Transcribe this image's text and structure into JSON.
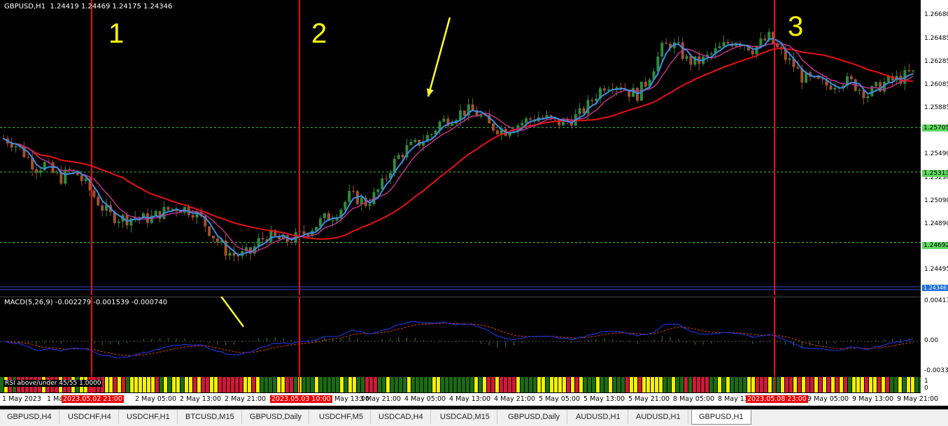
{
  "chart_header": {
    "symbol_line": "GBPUSD,H1  1.24419 1.24469 1.24175 1.24346"
  },
  "annotations": {
    "region_labels": [
      "1",
      "2",
      "3"
    ]
  },
  "colors": {
    "background": "#000000",
    "bull_candle": "#2e8b3a",
    "bear_candle": "#a0522d",
    "fast_ma": "#3a8ee6",
    "mid_ma": "#c0308a",
    "slow_ma": "#e81010",
    "vertical_lines": "#e81010",
    "arrows": "#ffff33",
    "level_lines": "#3cc83c"
  },
  "price_axis": {
    "labels": [
      "1.26680",
      "1.26485",
      "1.26285",
      "1.26085",
      "1.25885",
      "1.25490",
      "1.25290",
      "1.25090",
      "1.24890",
      "1.24495"
    ],
    "markers": [
      "1.25705",
      "1.25313",
      "1.24692"
    ],
    "current_price": "1.24346"
  },
  "macd": {
    "title": "MACD(5,26,9) -0.002279 -0.001539 -0.000740",
    "scale": [
      "0.00417",
      "0.00",
      "-0.00337"
    ]
  },
  "rsi": {
    "title": "RSI above/under 45/55 1.0000",
    "scale": [
      "1",
      "0"
    ]
  },
  "time_axis": {
    "labels": [
      "1 May 2023",
      "1 May",
      "2 May 05:00",
      "2 May 13:00",
      "2 May 21:00",
      "3 May 13:00",
      "3 May 21:00",
      "4 May 05:00",
      "4 May 13:00",
      "4 May 21:00",
      "5 May 05:00",
      "5 May 13:00",
      "5 May 21:00",
      "8 May 05:00",
      "8 May 13",
      "9 May 05:00",
      "9 May 13:00",
      "9 May 21:00"
    ],
    "markers": [
      "2023.05.02 21:00",
      "2023.05.03 10:00",
      "2023.05.08 23:00"
    ]
  },
  "tabs": [
    "GBPUSD,H4",
    "USDCHF,H4",
    "USDCHF,H1",
    "BTCUSD,M15",
    "GBPUSD,Daily",
    "USDCHF,M5",
    "USDCAD,H4",
    "USDCAD,M15",
    "GBPUSD,Daily",
    "AUDUSD,H1",
    "AUDUSD,H1",
    "GBPUSD,H1"
  ],
  "active_tab": "GBPUSD,H1",
  "chart_data": {
    "type": "candlestick",
    "symbol": "GBPUSD",
    "timeframe": "H1",
    "ylim": [
      1.243,
      1.268
    ],
    "close_path": [
      1.2561,
      1.2558,
      1.2552,
      1.2543,
      1.2535,
      1.2538,
      1.253,
      1.2526,
      1.2532,
      1.2529,
      1.252,
      1.251,
      1.25,
      1.2493,
      1.2491,
      1.249,
      1.2492,
      1.249,
      1.2491,
      1.2495,
      1.2498,
      1.25,
      1.2499,
      1.2497,
      1.249,
      1.248,
      1.247,
      1.2462,
      1.2458,
      1.2458,
      1.246,
      1.247,
      1.2475,
      1.2473,
      1.247,
      1.2472,
      1.2475,
      1.248,
      1.2485,
      1.249,
      1.2493,
      1.25,
      1.251,
      1.2508,
      1.2504,
      1.251,
      1.252,
      1.2535,
      1.2545,
      1.2552,
      1.2555,
      1.256,
      1.2565,
      1.2575,
      1.2578,
      1.2582,
      1.2585,
      1.2585,
      1.258,
      1.2572,
      1.257,
      1.2568,
      1.2572,
      1.2575,
      1.2578,
      1.258,
      1.2578,
      1.2575,
      1.2575,
      1.2578,
      1.2582,
      1.259,
      1.26,
      1.2608,
      1.261,
      1.2608,
      1.2602,
      1.26,
      1.261,
      1.2625,
      1.264,
      1.2645,
      1.264,
      1.263,
      1.2628,
      1.263,
      1.2635,
      1.264,
      1.2645,
      1.2648,
      1.2645,
      1.264,
      1.2645,
      1.265,
      1.264,
      1.2632,
      1.2625,
      1.2615,
      1.2612,
      1.261,
      1.2608,
      1.261,
      1.2612,
      1.261,
      1.2605,
      1.26,
      1.2605,
      1.261,
      1.2612,
      1.2614,
      1.2618
    ]
  }
}
